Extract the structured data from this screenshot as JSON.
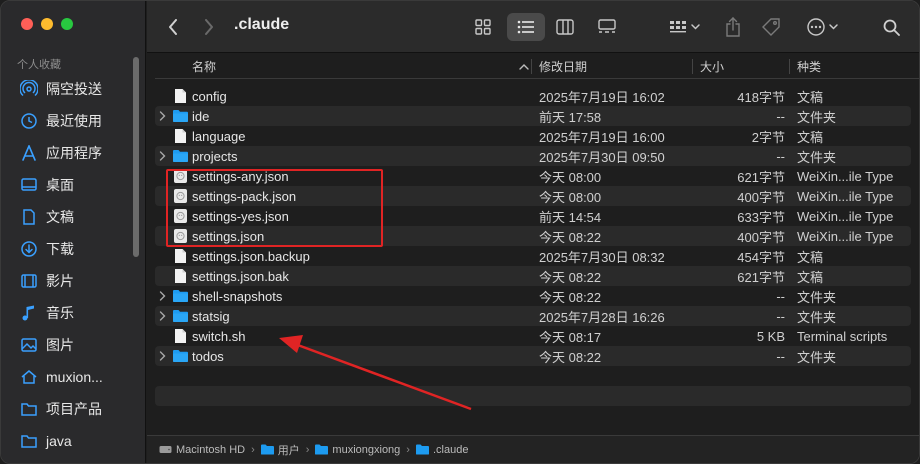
{
  "window": {
    "title": ".claude"
  },
  "sidebar": {
    "section_label": "个人收藏",
    "items": [
      {
        "label": "隔空投送",
        "icon": "airdrop-icon"
      },
      {
        "label": "最近使用",
        "icon": "clock-icon"
      },
      {
        "label": "应用程序",
        "icon": "applications-icon"
      },
      {
        "label": "桌面",
        "icon": "desktop-icon"
      },
      {
        "label": "文稿",
        "icon": "document-icon"
      },
      {
        "label": "下载",
        "icon": "download-icon"
      },
      {
        "label": "影片",
        "icon": "film-icon"
      },
      {
        "label": "音乐",
        "icon": "music-icon"
      },
      {
        "label": "图片",
        "icon": "photo-icon"
      },
      {
        "label": "muxion...",
        "icon": "home-icon"
      },
      {
        "label": "项目产品",
        "icon": "folder-icon"
      },
      {
        "label": "java",
        "icon": "folder-icon"
      }
    ]
  },
  "columns": {
    "name": "名称",
    "date": "修改日期",
    "size": "大小",
    "kind": "种类"
  },
  "files": [
    {
      "name": "config",
      "date": "2025年7月19日 16:02",
      "size": "418字节",
      "kind": "文稿",
      "type": "file",
      "expandable": false
    },
    {
      "name": "ide",
      "date": "前天 17:58",
      "size": "--",
      "kind": "文件夹",
      "type": "folder",
      "expandable": true
    },
    {
      "name": "language",
      "date": "2025年7月19日 16:00",
      "size": "2字节",
      "kind": "文稿",
      "type": "file",
      "expandable": false
    },
    {
      "name": "projects",
      "date": "2025年7月30日 09:50",
      "size": "--",
      "kind": "文件夹",
      "type": "folder",
      "expandable": true
    },
    {
      "name": "settings-any.json",
      "date": "今天 08:00",
      "size": "621字节",
      "kind": "WeiXin...ile Type",
      "type": "json",
      "expandable": false
    },
    {
      "name": "settings-pack.json",
      "date": "今天 08:00",
      "size": "400字节",
      "kind": "WeiXin...ile Type",
      "type": "json",
      "expandable": false
    },
    {
      "name": "settings-yes.json",
      "date": "前天 14:54",
      "size": "633字节",
      "kind": "WeiXin...ile Type",
      "type": "json",
      "expandable": false
    },
    {
      "name": "settings.json",
      "date": "今天 08:22",
      "size": "400字节",
      "kind": "WeiXin...ile Type",
      "type": "json",
      "expandable": false
    },
    {
      "name": "settings.json.backup",
      "date": "2025年7月30日 08:32",
      "size": "454字节",
      "kind": "文稿",
      "type": "file",
      "expandable": false
    },
    {
      "name": "settings.json.bak",
      "date": "今天 08:22",
      "size": "621字节",
      "kind": "文稿",
      "type": "file",
      "expandable": false
    },
    {
      "name": "shell-snapshots",
      "date": "今天 08:22",
      "size": "--",
      "kind": "文件夹",
      "type": "folder",
      "expandable": true
    },
    {
      "name": "statsig",
      "date": "2025年7月28日 16:26",
      "size": "--",
      "kind": "文件夹",
      "type": "folder",
      "expandable": true
    },
    {
      "name": "switch.sh",
      "date": "今天 08:17",
      "size": "5 KB",
      "kind": "Terminal scripts",
      "type": "file",
      "expandable": false
    },
    {
      "name": "todos",
      "date": "今天 08:22",
      "size": "--",
      "kind": "文件夹",
      "type": "folder",
      "expandable": true
    }
  ],
  "pathbar": [
    {
      "label": "Macintosh HD",
      "icon": "disk-icon"
    },
    {
      "label": "用户",
      "icon": "folder-icon"
    },
    {
      "label": "muxiongxiong",
      "icon": "home-folder-icon"
    },
    {
      "label": ".claude",
      "icon": "folder-icon"
    }
  ],
  "colors": {
    "folder": "#1d9bf0",
    "highlight": "#e02424",
    "arrow": "#e02424"
  }
}
